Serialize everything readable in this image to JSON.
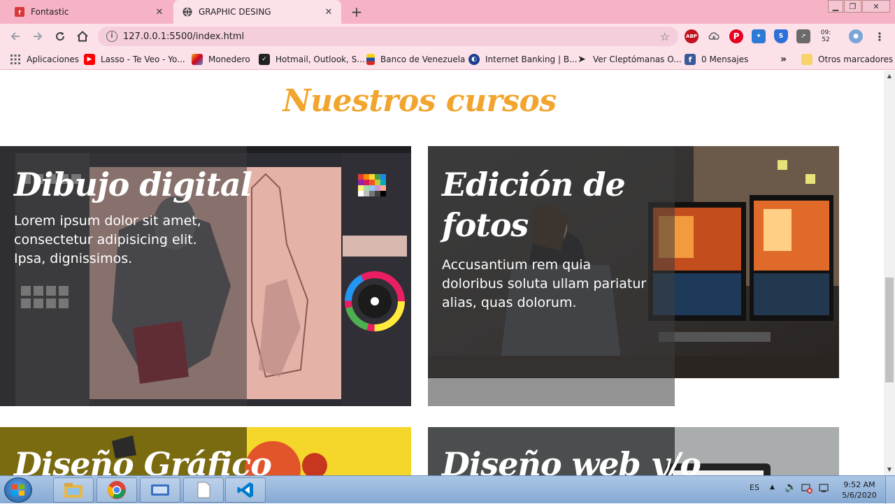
{
  "browser": {
    "tabs": [
      {
        "title": "Fontastic",
        "icon": "fontastic-icon",
        "active": false
      },
      {
        "title": "GRAPHIC DESING",
        "icon": "globe-icon",
        "active": true
      }
    ],
    "url": "127.0.0.1:5500/index.html",
    "bookmarks": [
      {
        "label": "Aplicaciones",
        "icon": "apps-grid-icon"
      },
      {
        "label": "Lasso - Te Veo - Yo...",
        "icon": "youtube-icon"
      },
      {
        "label": "Monedero",
        "icon": "wallet-icon"
      },
      {
        "label": "Hotmail, Outlook, S...",
        "icon": "outlook-icon"
      },
      {
        "label": "Banco de Venezuela",
        "icon": "bank-icon"
      },
      {
        "label": "Internet Banking | B...",
        "icon": "bank-globe-icon"
      },
      {
        "label": "Ver Cleptómanas O...",
        "icon": "play-icon"
      },
      {
        "label": "0 Mensajes",
        "icon": "facebook-icon"
      }
    ],
    "other_bookmarks": "Otros marcadores",
    "more_bookmarks": "»",
    "extension_clock": "09:\n52"
  },
  "page": {
    "section_title": "Nuestros cursos",
    "cards": [
      {
        "heading": "Dibujo digital",
        "text": "Lorem ipsum dolor sit amet, consectetur adipisicing elit. Ipsa, dignissimos."
      },
      {
        "heading": "Edición de fotos",
        "text": "Accusantium rem quia doloribus soluta ullam pariatur alias, quas dolorum."
      },
      {
        "heading": "Diseño Gráfico",
        "text": ""
      },
      {
        "heading": "Diseño web y/o",
        "text": ""
      }
    ]
  },
  "taskbar": {
    "language": "ES",
    "time": "9:52 AM",
    "date": "5/6/2020"
  },
  "colors": {
    "accent": "#f2a52e",
    "tabbar": "#f7b3c6",
    "toolbar": "#fce1e9"
  }
}
